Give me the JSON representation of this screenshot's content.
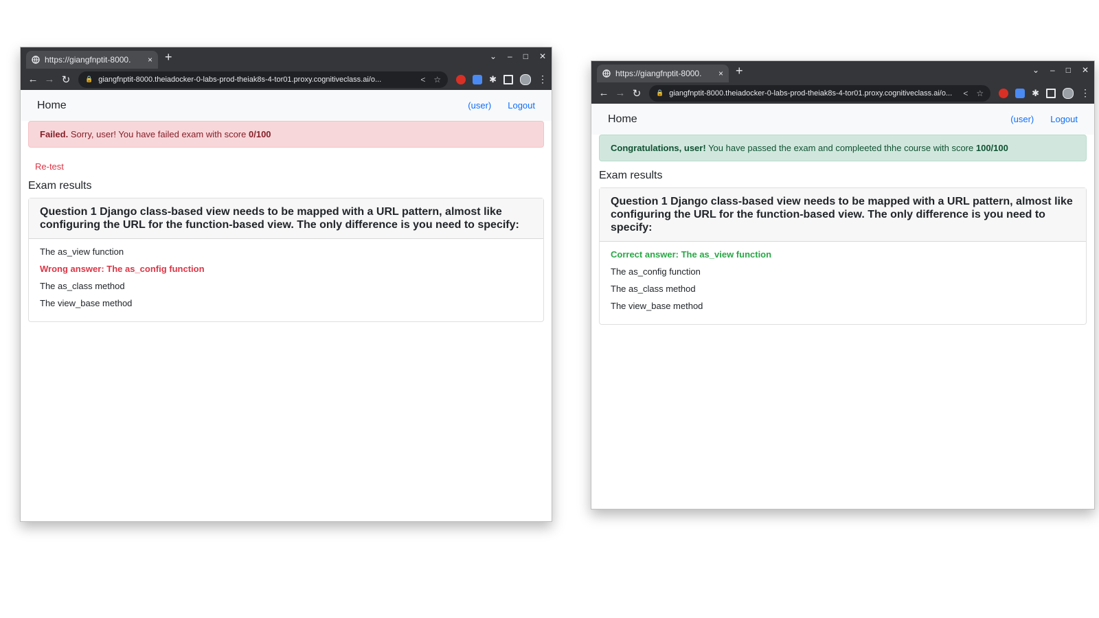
{
  "left_window": {
    "tab_title": "https://giangfnptit-8000.",
    "url": "giangfnptit-8000.theiadocker-0-labs-prod-theiak8s-4-tor01.proxy.cognitiveclass.ai/o...",
    "nav": {
      "brand": "Home",
      "user_link": "(user)",
      "logout_link": "Logout"
    },
    "alert": {
      "strong": "Failed.",
      "text": "Sorry, user! You have failed exam with score",
      "score": "0/100"
    },
    "retest_link": "Re-test",
    "results_heading": "Exam results",
    "question": "Question 1 Django class-based view needs to be mapped with a URL pattern, almost like configuring the URL for the function-based view. The only difference is you need to specify:",
    "options": [
      "The as_view function",
      "Wrong answer: The as_config function",
      "The as_class method",
      "The view_base method"
    ]
  },
  "right_window": {
    "tab_title": "https://giangfnptit-8000.",
    "url": "giangfnptit-8000.theiadocker-0-labs-prod-theiak8s-4-tor01.proxy.cognitiveclass.ai/o...",
    "nav": {
      "brand": "Home",
      "user_link": "(user)",
      "logout_link": "Logout"
    },
    "alert": {
      "strong": "Congratulations, user!",
      "text": "You have passed the exam and compleeted thhe course with score",
      "score": "100/100"
    },
    "results_heading": "Exam results",
    "question": "Question 1 Django class-based view needs to be mapped with a URL pattern, almost like configuring the URL for the function-based view. The only difference is you need to specify:",
    "options": [
      "Correct answer: The as_view function",
      "The as_config function",
      "The as_class method",
      "The view_base method"
    ]
  },
  "icons": {
    "close": "×",
    "new_tab": "+",
    "back": "←",
    "forward": "→",
    "reload": "↻",
    "tab_search": "⌄",
    "minimize": "–",
    "maximize": "□",
    "window_close": "✕",
    "lock": "🔒",
    "share": "<",
    "star": "☆",
    "puzzle": "✱",
    "menu": "⋮"
  },
  "colors": {
    "danger": "#dc3545",
    "success": "#28a745",
    "link": "#0d6efd"
  }
}
